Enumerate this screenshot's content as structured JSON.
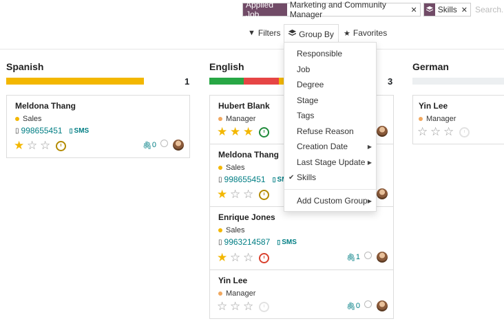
{
  "search": {
    "facets": [
      {
        "label": "Applied Job",
        "value": "Marketing and Community Manager"
      },
      {
        "label_icon": "layers-icon",
        "value": "Skills"
      }
    ],
    "placeholder": "Search..."
  },
  "controls": {
    "filters": "Filters",
    "group_by": "Group By",
    "favorites": "Favorites"
  },
  "groupby_menu": {
    "items": [
      "Responsible",
      "Job",
      "Degree",
      "Stage",
      "Tags",
      "Refuse Reason",
      "Creation Date",
      "Last Stage Update",
      "Skills",
      "Add Custom Group"
    ],
    "checked": "Skills"
  },
  "colors": {
    "brand": "#714B67",
    "star": "#f3b700",
    "link": "#017e84",
    "progress_yellow": "#f3b700",
    "progress_green": "#28a745",
    "progress_red": "#e64545"
  },
  "columns": [
    {
      "title": "Spanish",
      "count": "1",
      "cards": [
        {
          "name": "Meldona Thang",
          "tag": "Sales",
          "phone": "998655451",
          "sms": "SMS",
          "stars": 1,
          "attachments": "0"
        }
      ]
    },
    {
      "title": "English",
      "count": "3",
      "cards": [
        {
          "name": "Hubert Blank",
          "tag": "Manager",
          "stars": 3
        },
        {
          "name": "Meldona Thang",
          "tag": "Sales",
          "phone": "998655451",
          "sms": "SMS",
          "stars": 1
        },
        {
          "name": "Enrique Jones",
          "tag": "Sales",
          "phone": "9963214587",
          "sms": "SMS",
          "stars": 1,
          "attachments": "1"
        },
        {
          "name": "Yin Lee",
          "tag": "Manager",
          "stars": 0,
          "attachments": "0"
        }
      ]
    },
    {
      "title": "German",
      "cards": [
        {
          "name": "Yin Lee",
          "tag": "Manager",
          "stars": 0
        }
      ]
    }
  ]
}
